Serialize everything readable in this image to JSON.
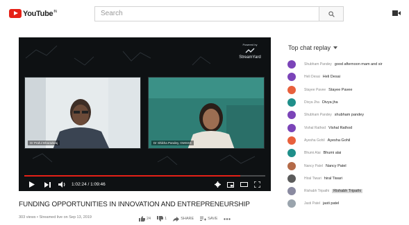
{
  "header": {
    "logo_text": "YouTube",
    "search_placeholder": "Search"
  },
  "player": {
    "powered_by_label": "Powered by",
    "powered_by_brand": "StreamYard",
    "participants": [
      {
        "name": "Dr Praful Bharadwaj"
      },
      {
        "name": "Dr Shikha Pandey, GMSSS"
      }
    ],
    "time_display": "1:02:24 / 1:09:46",
    "progress": 0.895,
    "colors": {
      "progress": "#e62117"
    }
  },
  "video": {
    "title": "FUNDING OPPORTUNITIES IN INNOVATION AND ENTREPRENEURSHIP",
    "meta": "303 views • Streamed live on Sep 13, 2019",
    "likes": "24",
    "dislikes": "1",
    "share_label": "SHARE",
    "save_label": "SAVE"
  },
  "chat": {
    "header": "Top chat replay",
    "messages": [
      {
        "author": "Shubham Pandey",
        "text": "good afternoon mam and sir",
        "color": "#7b44b8",
        "highlight": false
      },
      {
        "author": "Heli Desai",
        "text": "Heli Desai",
        "color": "#7b44b8",
        "highlight": false
      },
      {
        "author": "Stayee Pavee",
        "text": "Stayee Pavee",
        "color": "#e8603c",
        "highlight": false
      },
      {
        "author": "Divya Jha",
        "text": "Divya jha",
        "color": "#1f8f8a",
        "highlight": false
      },
      {
        "author": "Shubham Pandey",
        "text": "shubham pandey",
        "color": "#7b44b8",
        "highlight": false
      },
      {
        "author": "Vishal Rathod",
        "text": "Vishal Rathod",
        "color": "#7b44b8",
        "highlight": false
      },
      {
        "author": "Ayesha Gohil",
        "text": "Ayesha Gohil",
        "color": "#e8603c",
        "highlight": false
      },
      {
        "author": "Bhumi Alai",
        "text": "Bhumi alai",
        "color": "#1f8f8a",
        "highlight": false
      },
      {
        "author": "Nancy Patel",
        "text": "Nancy Patel",
        "color": "#b46a48",
        "highlight": false
      },
      {
        "author": "Hiral Tiwari",
        "text": "hiral Tiwari",
        "color": "#5b5b5b",
        "highlight": false
      },
      {
        "author": "Rishabh Tripathi",
        "text": "Rishabh Tripathi",
        "color": "#8a8aa0",
        "highlight": true
      },
      {
        "author": "Jasti Patel",
        "text": "jasti patel",
        "color": "#9aa4ad",
        "highlight": false
      }
    ]
  }
}
